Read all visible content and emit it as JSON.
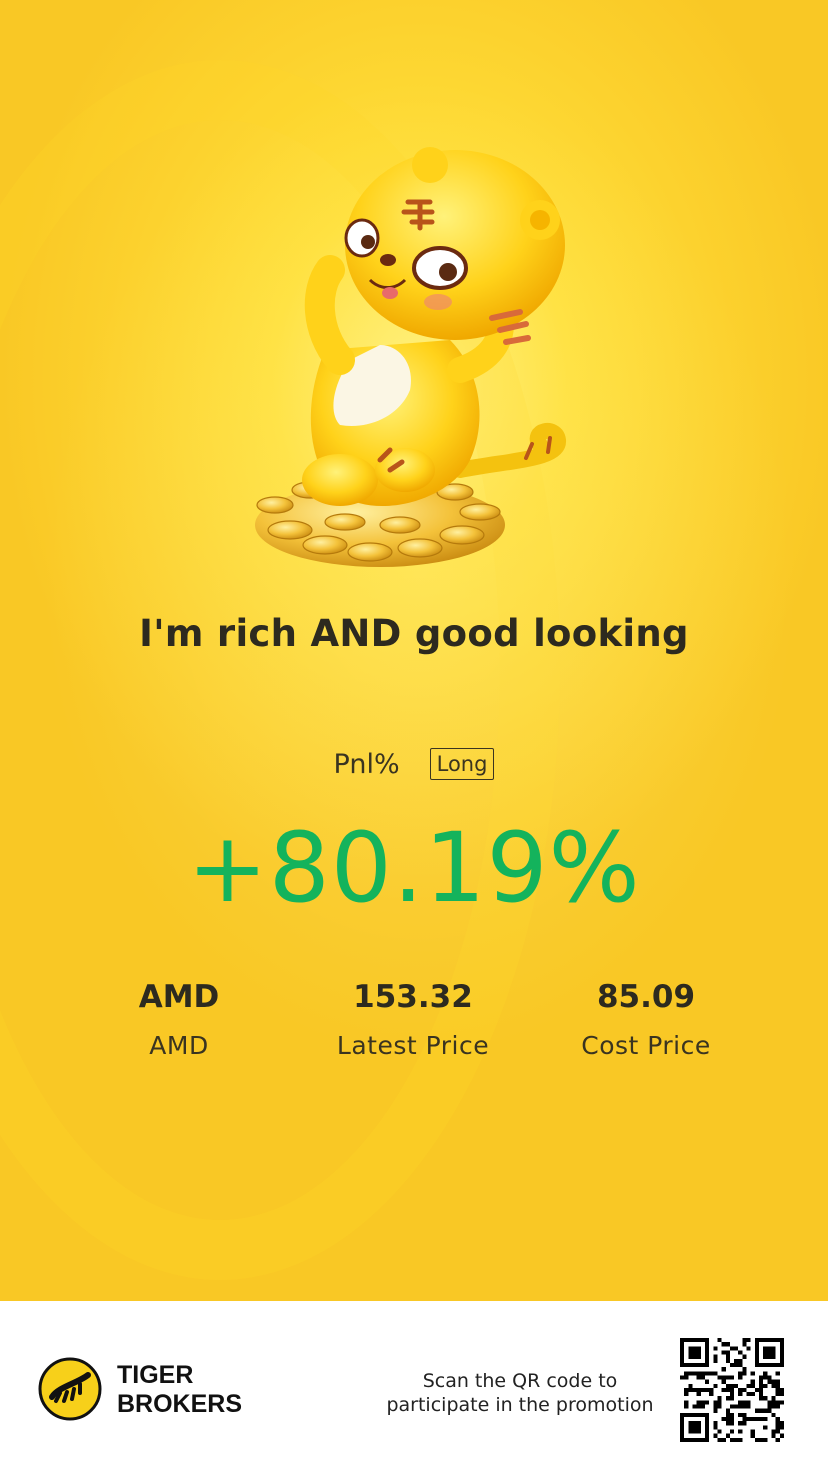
{
  "poster": {
    "headline": "I'm rich AND good looking",
    "pnl_label": "Pnl%",
    "position_badge": "Long",
    "pnl_value": "+80.19%",
    "pnl_color": "#14b35c",
    "stats": [
      {
        "value": "AMD",
        "label": "AMD"
      },
      {
        "value": "153.32",
        "label": "Latest Price"
      },
      {
        "value": "85.09",
        "label": "Cost Price"
      }
    ]
  },
  "footer": {
    "brand_line1": "TIGER",
    "brand_line2": "BROKERS",
    "scan_line1": "Scan the QR code to",
    "scan_line2": "participate in the promotion"
  },
  "colors": {
    "background": "#fcd22e",
    "brand_yellow": "#f7d01a"
  }
}
